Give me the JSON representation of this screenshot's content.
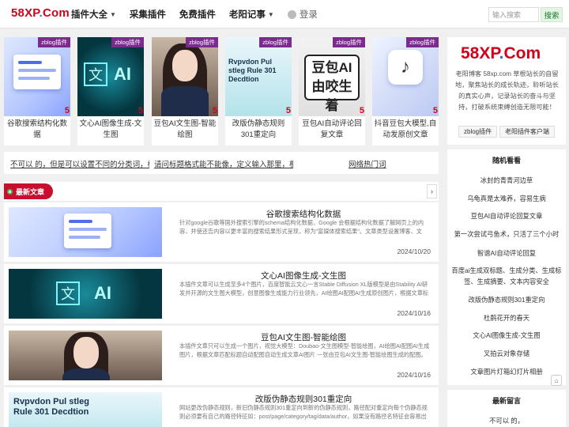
{
  "header": {
    "logo_a": "58XP",
    "logo_dot": ".",
    "logo_b": "Com",
    "nav": [
      "插件大全",
      "采集插件",
      "免费插件",
      "老阳记事"
    ],
    "login": "登录",
    "search_placeholder": "输入搜索",
    "search_button": "搜索"
  },
  "featured": [
    {
      "title": "谷歌搜索结构化数据",
      "badge": "zblog插件",
      "num": "5"
    },
    {
      "title": "文心AI图像生成-文生图",
      "badge": "zblog插件",
      "num": "5"
    },
    {
      "title": "豆包AI文生图-智能绘图",
      "badge": "zblog插件",
      "num": "5"
    },
    {
      "title": "改版伪静态规则301重定向",
      "badge": "zblog插件",
      "num": "5"
    },
    {
      "title": "豆包AI自动评论回复文章",
      "badge": "zblog插件",
      "num": "5"
    },
    {
      "title": "抖音豆包大模型,自动发原创文章",
      "badge": "zblog插件",
      "num": "5"
    }
  ],
  "thumb_text": {
    "wen": "文",
    "ai": "AI",
    "rule": "Rvpvdon Pul stleg Rule 301 Decdtion",
    "doubao": "豆包AI 由咬生着",
    "tiktok": "♪"
  },
  "ticker": [
    "不可以 的，但是可以设置不同的分类词，标题...",
    "请问标题格式能不能像，定义输入那里，根据...",
    "网络热门词"
  ],
  "latest": {
    "label": "最新文章",
    "next": "›",
    "articles": [
      {
        "title": "谷歌搜索结构化数据",
        "summary": "针对google谷歌等国外搜索引擎的schema结构化数据，Google 会根据结构化数据了解网页上的内容，并使还告内容以更丰富的搜索结果形式呈现，称为\"富媒体搜索结果\"。文章类型设置博客、文章、...",
        "date": "2024/10/20"
      },
      {
        "title": "文心AI图像生成-文生图",
        "summary": "本插件文章可以生成至多4个图片，百度智能云文心一言Stable Diffusion XL版模型是由Stability AI研发并开源的文生图大模型，创意图像生成能力行业领先，AI绘图AI配图AI生成原创图片，根据文章标题...",
        "date": "2024/10/16"
      },
      {
        "title": "豆包AI文生图-智能绘图",
        "summary": "本插件文章只可以生成一个图片，视觉大模型：Doubao-文生图模型-智能绘图，AI绘图AI配图AI生成图片，根据文章匹配标题自动配图自动生成文章AI图片 一张由豆包AI文生图-智能绘图生成的配图。请...",
        "date": "2024/10/16"
      },
      {
        "title": "改版伪静态规则301重定向",
        "summary": "网站更改伪静态规则，新旧伪静态规则301重定向到新的伪静态规则，路径配对重定向每个伪静态规则必须要有自己的路径特征如：post/page/category/tag/data/author，如果没有路径名特征会容易出现...",
        "date": ""
      }
    ]
  },
  "side": {
    "logo_a": "58XP",
    "logo_dot": ".",
    "logo_b": "Com",
    "desc": "老阳博客 58xp.com 草根站长的自留地，聚焦站长的成长轨迹，聆听站长的真实心声，记录站长的奋斗与坚持，打破系统束缚创造无限可能！",
    "tag1": "zblog插件",
    "tag2": "老阳插件客户端",
    "random_title": "随机看看",
    "random_items": [
      "冰封的青青河边草",
      "乌龟真是太难养，容易生病",
      "豆包AI自动评论回复文章",
      "第一次尝试弓鱼术，只活了三个小时",
      "智谱AI自动评论回复",
      "百度ai生成双标题、生成分类、生成标签、生成摘要、文本内容安全",
      "改版伪静态规则301重定向",
      "杜鹃花开的春天",
      "文心AI图像生成-文生图",
      "叉拍云对象存储",
      "文章图片灯箱幻灯片相册"
    ],
    "comments_title": "最新留言",
    "comment_1": "不可以 的，",
    "float_icon": "⌂"
  },
  "colors": {
    "brand_red": "#d0021b",
    "brand_blue": "#2f6fd6",
    "badge_purple": "#7b2b8e",
    "search_green": "#1a7f2e"
  }
}
